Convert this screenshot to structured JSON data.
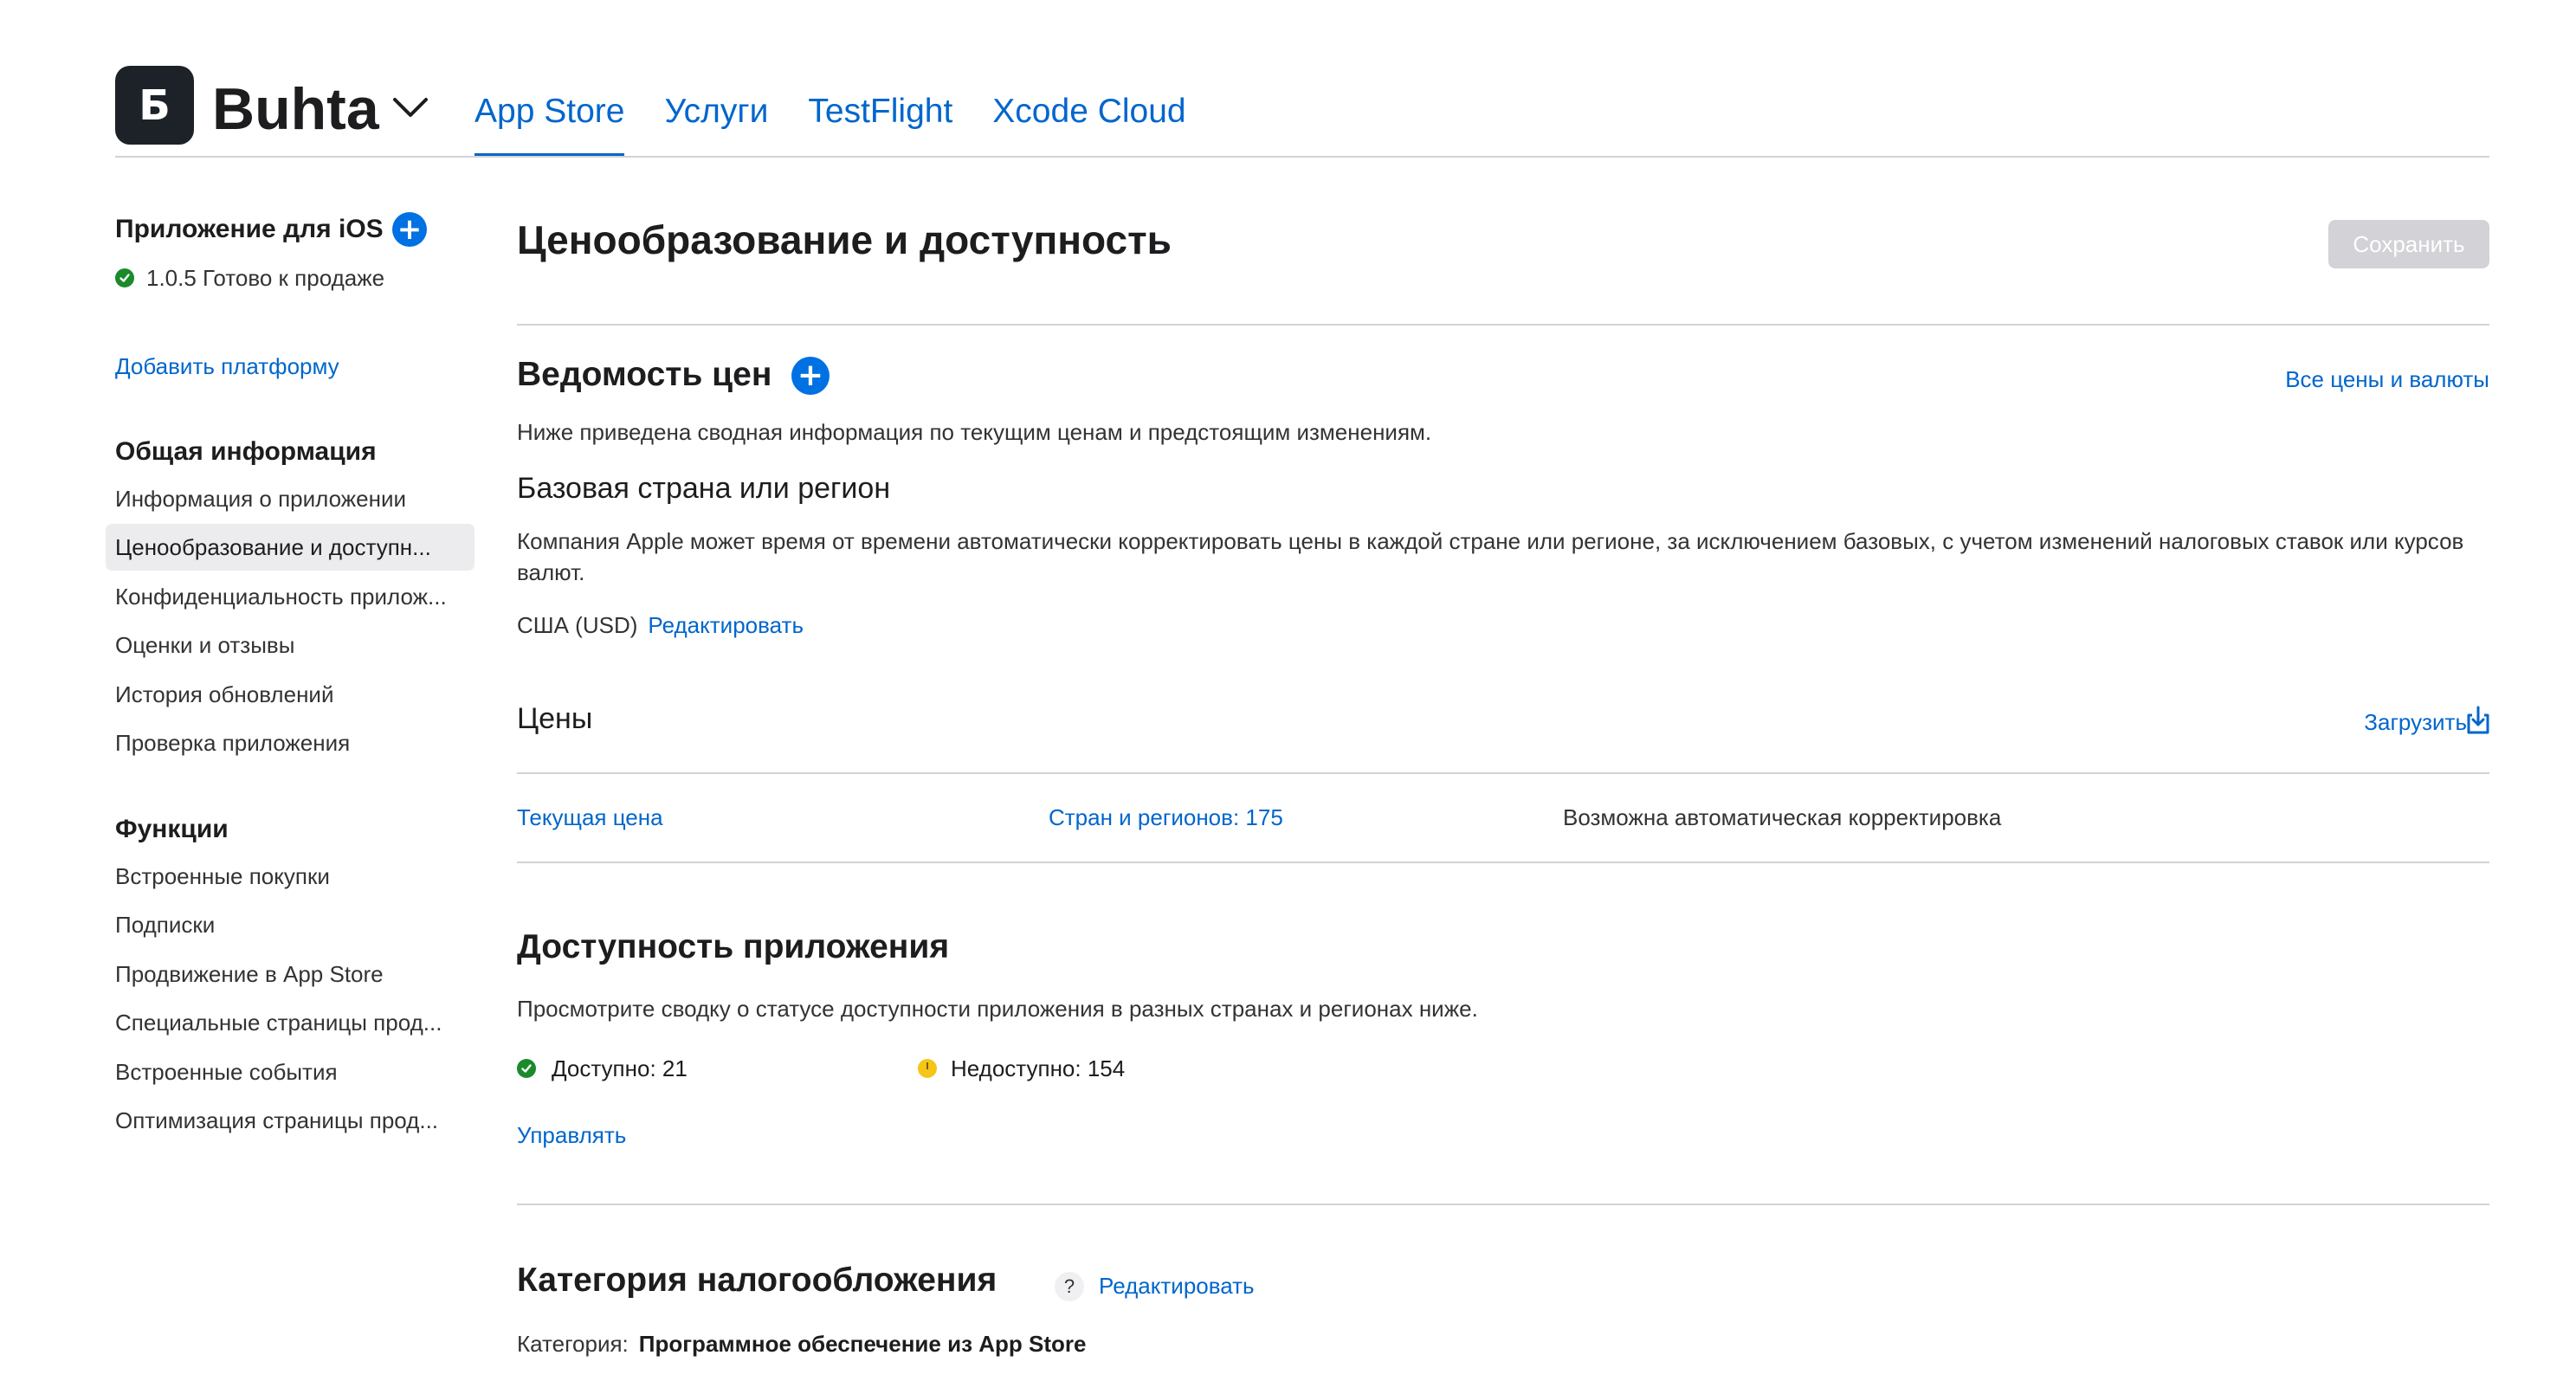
{
  "app": {
    "logo_glyph": "Б",
    "name": "Buhta"
  },
  "top_nav": {
    "tabs": [
      {
        "label": "App Store",
        "active": true
      },
      {
        "label": "Услуги"
      },
      {
        "label": "TestFlight"
      },
      {
        "label": "Xcode Cloud"
      }
    ]
  },
  "sidebar": {
    "platform_title": "Приложение для iOS",
    "platform_status": "1.0.5 Готово к продаже",
    "add_platform": "Добавить платформу",
    "general": {
      "heading": "Общая информация",
      "items": [
        "Информация о приложении",
        "Ценообразование и доступн...",
        "Конфиденциальность прилож...",
        "Оценки и отзывы",
        "История обновлений",
        "Проверка приложения"
      ]
    },
    "features": {
      "heading": "Функции",
      "items": [
        "Встроенные покупки",
        "Подписки",
        "Продвижение в App Store",
        "Специальные страницы прод...",
        "Встроенные события",
        "Оптимизация страницы прод..."
      ]
    }
  },
  "main": {
    "title": "Ценообразование и доступность",
    "save_label": "Сохранить",
    "price_schedule": {
      "title": "Ведомость цен",
      "all_prices_link": "Все цены и валюты",
      "description": "Ниже приведена сводная информация по текущим ценам и предстоящим изменениям.",
      "base_country_title": "Базовая страна или регион",
      "base_country_description": "Компания Apple может время от времени автоматически корректировать цены в каждой стране или регионе, за исключением базовых, с учетом изменений налоговых ставок или курсов валют.",
      "base_country_value": "США (USD)",
      "edit_link": "Редактировать"
    },
    "prices": {
      "title": "Цены",
      "download_link": "Загрузить",
      "current_price": "Текущая цена",
      "countries": "Стран и регионов: 175",
      "auto_adjust": "Возможна автоматическая корректировка"
    },
    "availability": {
      "title": "Доступность приложения",
      "description": "Просмотрите сводку о статусе доступности приложения в разных странах и регионах ниже.",
      "available": "Доступно: 21",
      "unavailable": "Недоступно: 154",
      "manage_link": "Управлять"
    },
    "tax": {
      "title": "Категория налогообложения",
      "help_glyph": "?",
      "edit_link": "Редактировать",
      "category_label": "Категория:",
      "category_value": "Программное обеспечение из App Store"
    }
  }
}
